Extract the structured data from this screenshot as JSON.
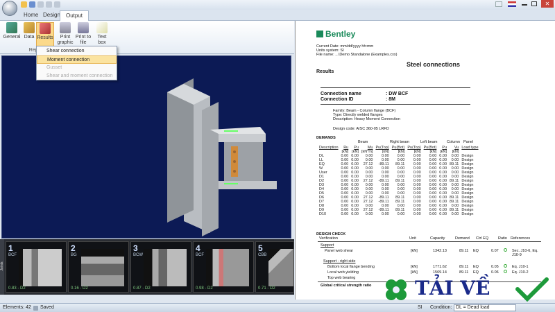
{
  "ribbon": {
    "tabs": [
      "Home",
      "Design",
      "Output"
    ],
    "active_tab": "Output",
    "buttons": [
      {
        "label": "General",
        "icon": "general-icon"
      },
      {
        "label": "Data",
        "icon": "data-icon"
      },
      {
        "label": "Results",
        "icon": "results-icon"
      },
      {
        "label": "Print graphic",
        "icon": "printer-icon"
      },
      {
        "label": "Print to file",
        "icon": "print-to-file-icon"
      },
      {
        "label": "Text box",
        "icon": "text-box-icon"
      }
    ],
    "group_label": "Reports"
  },
  "results_menu": {
    "items": [
      {
        "label": "Shear connection",
        "state": "normal"
      },
      {
        "label": "Moment connection",
        "state": "highlighted"
      },
      {
        "label": "Gusset",
        "state": "disabled"
      },
      {
        "label": "Shear and moment connection",
        "state": "disabled"
      }
    ]
  },
  "thumbnails": [
    {
      "num": "1",
      "label": "BCF",
      "foot": "0.83 - D2"
    },
    {
      "num": "2",
      "label": "BG",
      "foot": "0.16 - D2"
    },
    {
      "num": "3",
      "label": "BCW",
      "foot": "0.87 - D2"
    },
    {
      "num": "4",
      "label": "BCF",
      "foot": "0.98 - D2"
    },
    {
      "num": "5",
      "label": "CBB",
      "foot": "0.71 - D2"
    }
  ],
  "thumb_sidebar_label": "Joints",
  "report": {
    "logo": "Bentley",
    "current_date": "Current Date: mm/dd/yyyy hh:mm",
    "units_system": "Units system: SI",
    "file_name": "File name: ...\\Demo Standalone (Examples.cxx)",
    "title": "Steel connections",
    "results_heading": "Results",
    "conn_name_label": "Connection name",
    "conn_name_value": ": DW BCF",
    "conn_id_label": "Connection ID",
    "conn_id_value": ": 8M",
    "family": "Family: Beam - Column flange (BCF)",
    "type": "Type: Directly welded flanges",
    "description": "Description: Heavy Moment Connection",
    "design_code": "Design code: AISC 360-05 LRFD",
    "demands_heading": "DEMANDS",
    "group_headers": [
      "Beam",
      "Right beam",
      "Left beam",
      "Column",
      "Panel"
    ],
    "col_headers": [
      "Description",
      "Ru",
      "Pu",
      "Mu",
      "Pu(Top)",
      "Pu(Bot)",
      "Pu(Top)",
      "Pu(Bot)",
      "Pu",
      "Vu",
      "Load type"
    ],
    "unit_row": [
      "",
      "[kN]",
      "[kN]",
      "[kN*m]",
      "[kN]",
      "[kN]",
      "[kN]",
      "[kN]",
      "[kN]",
      "[kN]",
      ""
    ],
    "rows": [
      [
        "DL",
        "0.00",
        "0.00",
        "0.00",
        "0.00",
        "0.00",
        "0.00",
        "0.00",
        "0.00",
        "0.00",
        "Design"
      ],
      [
        "LL",
        "0.00",
        "0.00",
        "0.00",
        "0.00",
        "0.00",
        "0.00",
        "0.00",
        "0.00",
        "0.00",
        "Design"
      ],
      [
        "EQ",
        "0.00",
        "0.00",
        "27.12",
        "-89.11",
        "89.11",
        "0.00",
        "0.00",
        "0.00",
        "89.11",
        "Design"
      ],
      [
        "W",
        "0.00",
        "0.00",
        "0.00",
        "0.00",
        "0.00",
        "0.00",
        "0.00",
        "0.00",
        "0.00",
        "Design"
      ],
      [
        "User",
        "0.00",
        "0.00",
        "0.00",
        "0.00",
        "0.00",
        "0.00",
        "0.00",
        "0.00",
        "0.00",
        "Design"
      ],
      [
        "D1",
        "0.00",
        "0.00",
        "0.00",
        "0.00",
        "0.00",
        "0.00",
        "0.00",
        "0.00",
        "0.00",
        "Design"
      ],
      [
        "D2",
        "0.00",
        "0.00",
        "27.12",
        "-89.11",
        "89.11",
        "0.00",
        "0.00",
        "0.00",
        "89.11",
        "Design"
      ],
      [
        "D3",
        "0.00",
        "0.00",
        "0.00",
        "0.00",
        "0.00",
        "0.00",
        "0.00",
        "0.00",
        "0.00",
        "Design"
      ],
      [
        "D4",
        "0.00",
        "0.00",
        "0.00",
        "0.00",
        "0.00",
        "0.00",
        "0.00",
        "0.00",
        "0.00",
        "Design"
      ],
      [
        "D5",
        "0.00",
        "0.00",
        "0.00",
        "0.00",
        "0.00",
        "0.00",
        "0.00",
        "0.00",
        "0.00",
        "Design"
      ],
      [
        "D6",
        "0.00",
        "0.00",
        "27.12",
        "-89.11",
        "89.11",
        "0.00",
        "0.00",
        "0.00",
        "89.11",
        "Design"
      ],
      [
        "D7",
        "0.00",
        "0.00",
        "27.12",
        "-89.11",
        "89.11",
        "0.00",
        "0.00",
        "0.00",
        "89.11",
        "Design"
      ],
      [
        "D8",
        "0.00",
        "0.00",
        "0.00",
        "0.00",
        "0.00",
        "0.00",
        "0.00",
        "0.00",
        "0.00",
        "Design"
      ],
      [
        "D9",
        "0.00",
        "0.00",
        "27.12",
        "-89.11",
        "89.11",
        "0.00",
        "0.00",
        "0.00",
        "89.11",
        "Design"
      ],
      [
        "D10",
        "0.00",
        "0.00",
        "0.00",
        "0.00",
        "0.00",
        "0.00",
        "0.00",
        "0.00",
        "0.00",
        "Design"
      ]
    ],
    "design_check_heading": "DESIGN CHECK",
    "dc_headers": [
      "Verification",
      "Unit",
      "Capacity",
      "Demand",
      "Ctrl EQ",
      "Ratio",
      "References"
    ],
    "support_label": "Support",
    "panel_web_shear": {
      "name": "Panel web shear",
      "unit": "[kN]",
      "capacity": "1342.13",
      "demand": "89.11",
      "ctrl": "EQ",
      "ratio": "0.07",
      "ref": "Sec. J10-6, Eq. J10-9"
    },
    "support_right_side": "Support - right side",
    "bottom_flange": {
      "name": "Bottom local flange bending",
      "unit": "[kN]",
      "capacity": "1771.62",
      "demand": "89.11",
      "ctrl": "EQ",
      "ratio": "0.05",
      "ref": "Eq. J10-1"
    },
    "local_web": {
      "name": "Local web yielding",
      "unit": "[kN]",
      "capacity": "1569.14",
      "demand": "89.11",
      "ctrl": "EQ",
      "ratio": "0.06",
      "ref": "Eq. J10-2"
    },
    "top_web": "Top web bearing",
    "global_ratio": "Global critical strength ratio"
  },
  "statusbar": {
    "elements": "Elements: 42",
    "saved": "Saved",
    "units": "SI",
    "condition": "Condition:",
    "condition_value": "DL = Dead load"
  },
  "watermark": {
    "text": "TẢI VỀ"
  }
}
